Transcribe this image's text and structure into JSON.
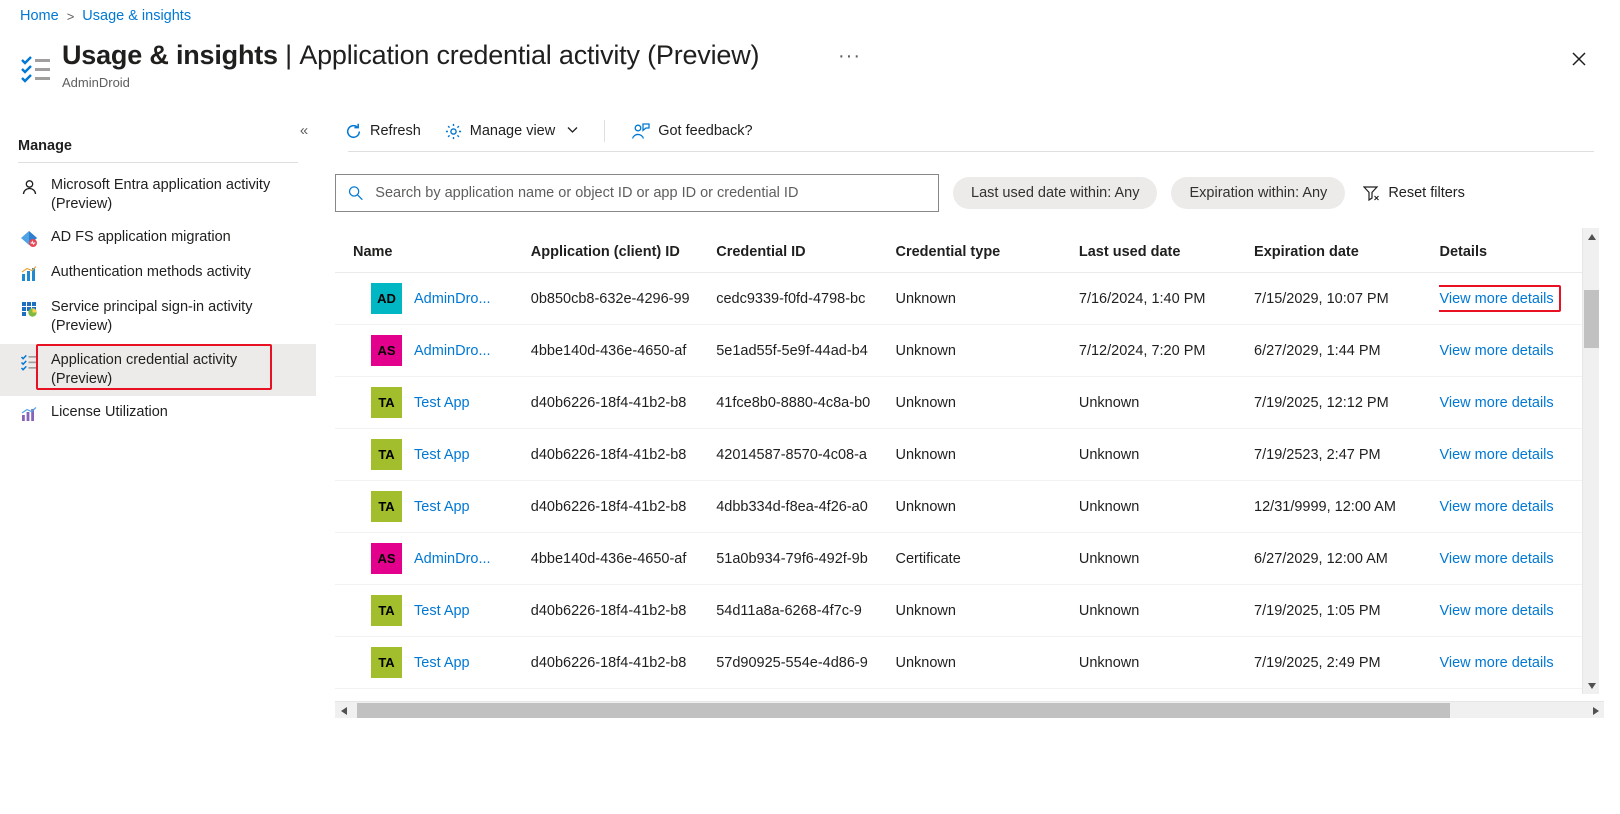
{
  "breadcrumb": {
    "home": "Home",
    "current": "Usage & insights",
    "separator": ">"
  },
  "header": {
    "title_main": "Usage & insights",
    "title_divider": "|",
    "title_sub": "Application credential activity (Preview)",
    "subtitle": "AdminDroid",
    "ellipsis": "···"
  },
  "sidebar": {
    "section_title": "Manage",
    "collapse_label": "«",
    "items": [
      {
        "label": "Microsoft Entra application activity (Preview)",
        "icon": "person-icon",
        "selected": false
      },
      {
        "label": "AD FS application migration",
        "icon": "adfs-diamond-icon",
        "selected": false
      },
      {
        "label": "Authentication methods activity",
        "icon": "bar-chart-icon",
        "selected": false
      },
      {
        "label": "Service principal sign-in activity (Preview)",
        "icon": "grid-pie-icon",
        "selected": false
      },
      {
        "label": "Application credential activity (Preview)",
        "icon": "checklist-icon",
        "selected": true
      },
      {
        "label": "License Utilization",
        "icon": "line-chart-icon",
        "selected": false
      }
    ]
  },
  "toolbar": {
    "refresh_label": "Refresh",
    "manage_view_label": "Manage view",
    "manage_view_chevron": "⌄",
    "feedback_label": "Got feedback?"
  },
  "search": {
    "placeholder": "Search by application name or object ID or app ID or credential ID",
    "value": ""
  },
  "filters": {
    "last_used": "Last used date within: Any",
    "expiration": "Expiration within: Any",
    "reset": "Reset filters"
  },
  "table": {
    "columns": [
      "Name",
      "Application (client) ID",
      "Credential ID",
      "Credential type",
      "Last used date",
      "Expiration date",
      "Details"
    ],
    "details_link_label": "View more details",
    "rows": [
      {
        "initials": "AD",
        "avatar_color": "#00B7C3",
        "name": "AdminDro...",
        "app_id": "0b850cb8-632e-4296-99",
        "credential_id": "cedc9339-f0fd-4798-bc",
        "credential_type": "Unknown",
        "last_used": "7/16/2024, 1:40 PM",
        "expiration": "7/15/2029, 10:07 PM",
        "details": "View more details",
        "highlighted": true
      },
      {
        "initials": "AS",
        "avatar_color": "#E3008C",
        "name": "AdminDro...",
        "app_id": "4bbe140d-436e-4650-af",
        "credential_id": "5e1ad55f-5e9f-44ad-b4",
        "credential_type": "Unknown",
        "last_used": "7/12/2024, 7:20 PM",
        "expiration": "6/27/2029, 1:44 PM",
        "details": "View more details",
        "highlighted": false
      },
      {
        "initials": "TA",
        "avatar_color": "#A3BE2D",
        "name": "Test App",
        "app_id": "d40b6226-18f4-41b2-b8",
        "credential_id": "41fce8b0-8880-4c8a-b0",
        "credential_type": "Unknown",
        "last_used": "Unknown",
        "expiration": "7/19/2025, 12:12 PM",
        "details": "View more details",
        "highlighted": false
      },
      {
        "initials": "TA",
        "avatar_color": "#A3BE2D",
        "name": "Test App",
        "app_id": "d40b6226-18f4-41b2-b8",
        "credential_id": "42014587-8570-4c08-a",
        "credential_type": "Unknown",
        "last_used": "Unknown",
        "expiration": "7/19/2523, 2:47 PM",
        "details": "View more details",
        "highlighted": false
      },
      {
        "initials": "TA",
        "avatar_color": "#A3BE2D",
        "name": "Test App",
        "app_id": "d40b6226-18f4-41b2-b8",
        "credential_id": "4dbb334d-f8ea-4f26-a0",
        "credential_type": "Unknown",
        "last_used": "Unknown",
        "expiration": "12/31/9999, 12:00 AM",
        "details": "View more details",
        "highlighted": false
      },
      {
        "initials": "AS",
        "avatar_color": "#E3008C",
        "name": "AdminDro...",
        "app_id": "4bbe140d-436e-4650-af",
        "credential_id": "51a0b934-79f6-492f-9b",
        "credential_type": "Certificate",
        "last_used": "Unknown",
        "expiration": "6/27/2029, 12:00 AM",
        "details": "View more details",
        "highlighted": false
      },
      {
        "initials": "TA",
        "avatar_color": "#A3BE2D",
        "name": "Test App",
        "app_id": "d40b6226-18f4-41b2-b8",
        "credential_id": "54d11a8a-6268-4f7c-9",
        "credential_type": "Unknown",
        "last_used": "Unknown",
        "expiration": "7/19/2025, 1:05 PM",
        "details": "View more details",
        "highlighted": false
      },
      {
        "initials": "TA",
        "avatar_color": "#A3BE2D",
        "name": "Test App",
        "app_id": "d40b6226-18f4-41b2-b8",
        "credential_id": "57d90925-554e-4d86-9",
        "credential_type": "Unknown",
        "last_used": "Unknown",
        "expiration": "7/19/2025, 2:49 PM",
        "details": "View more details",
        "highlighted": false
      }
    ]
  },
  "colors": {
    "accent_link": "#0078d4",
    "highlight_red": "#e81123",
    "selected_nav_bg": "#edebe9"
  },
  "scrollbars": {
    "vertical_up": "▲",
    "vertical_down": "▼",
    "horizontal_left": "◀",
    "horizontal_right": "▶"
  }
}
